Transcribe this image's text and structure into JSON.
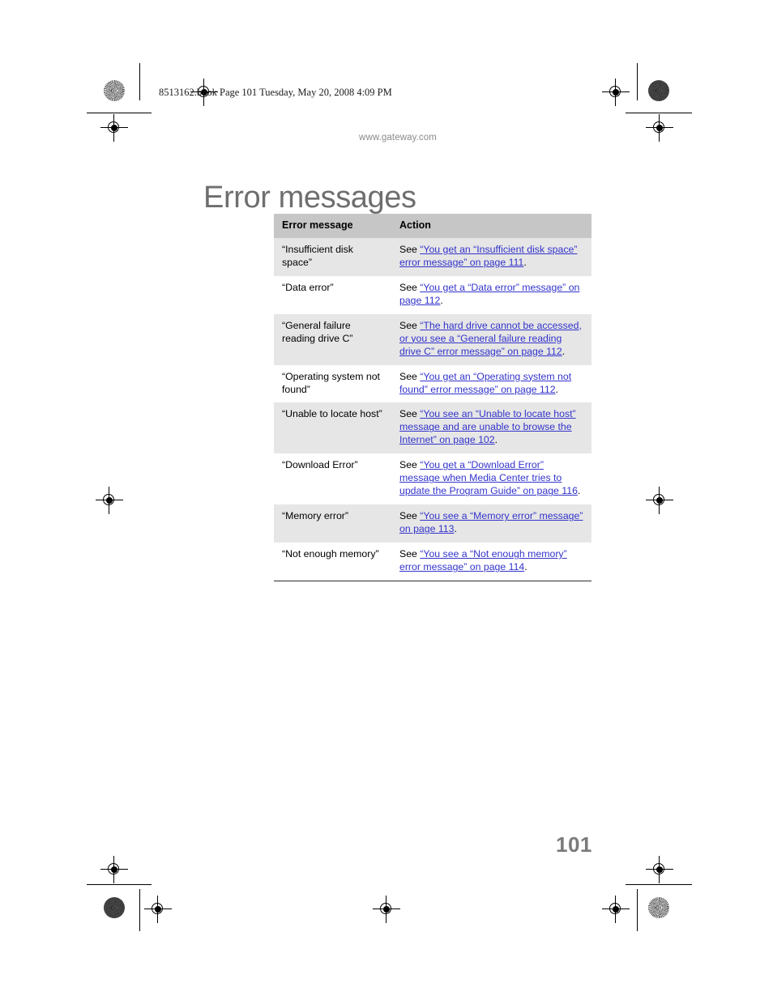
{
  "print_slug": "8513162.book  Page 101  Tuesday, May 20, 2008  4:09 PM",
  "site_url": "www.gateway.com",
  "page_title": "Error messages",
  "folio": "101",
  "colors": {
    "link": "#3333cc",
    "title_gray": "#6e6e6e",
    "header_fill": "#c6c6c6",
    "row_shade": "#e6e6e6",
    "folio_gray": "#7a7a7a"
  },
  "table": {
    "headers": [
      "Error message",
      "Action"
    ],
    "rows": [
      {
        "error": "“Insufficient disk space”",
        "see": "See ",
        "link": "“You get an “Insufficient disk space” error message” on page 111",
        "period": "."
      },
      {
        "error": "“Data error”",
        "see": "See ",
        "link": "“You get a “Data error” message” on page 112",
        "period": "."
      },
      {
        "error": "“General failure reading drive C”",
        "see": "See ",
        "link": "“The hard drive cannot be accessed, or you see a “General failure reading drive C” error message” on page 112",
        "period": "."
      },
      {
        "error": "“Operating system not found”",
        "see": "See ",
        "link": "“You get an “Operating system not found” error message” on page 112",
        "period": "."
      },
      {
        "error": "“Unable to locate host”",
        "see": "See ",
        "link": "“You see an “Unable to locate host” message and are unable to browse the Internet” on page 102",
        "period": "."
      },
      {
        "error": "“Download Error”",
        "see": "See ",
        "link": "“You get a “Download Error” message when Media Center tries to update the Program Guide” on page 116",
        "period": "."
      },
      {
        "error": "“Memory error”",
        "see": "See ",
        "link": "“You see a “Memory error” message” on page 113",
        "period": "."
      },
      {
        "error": "“Not enough memory”",
        "see": "See ",
        "link": "“You see a “Not enough memory” error message” on page 114",
        "period": "."
      }
    ]
  }
}
